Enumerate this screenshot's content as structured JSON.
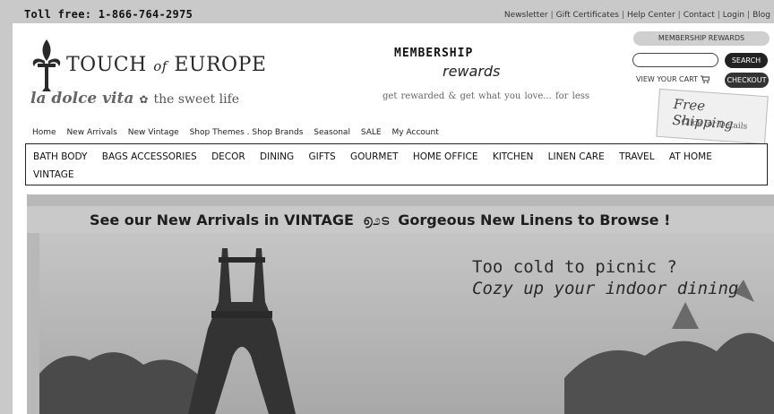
{
  "topbar": {
    "toll_free": "Toll free: 1-866-764-2975",
    "links": [
      "Newsletter",
      "Gift Certificates",
      "Help Center",
      "Contact",
      "Login",
      "Blog"
    ]
  },
  "logo": {
    "brand_left": "TOUCH",
    "brand_of": "of",
    "brand_right": "EUROPE",
    "tagline_script": "la dolce vita",
    "tagline_sep": "✿",
    "tagline_text": "the sweet life"
  },
  "membership": {
    "title": "MEMBERSHIP",
    "rewards": "rewards",
    "subtitle": "get rewarded  &  get what you love...  for less"
  },
  "utility": {
    "membership_rewards_label": "MEMBERSHIP REWARDS",
    "search_placeholder": "",
    "search_label": "SEARCH",
    "view_cart_label": "VIEW YOUR CART",
    "checkout_label": "CHECKOUT",
    "free_shipping_title": "Free Shipping",
    "free_shipping_sub": "Click for Details"
  },
  "main_nav": [
    "Home",
    "New Arrivals",
    "New Vintage",
    "Shop Themes . Shop Brands",
    "Seasonal",
    "SALE",
    "My Account"
  ],
  "categories_row1": [
    "BATH BODY",
    "BAGS ACCESSORIES",
    "DECOR",
    "DINING",
    "GIFTS",
    "GOURMET",
    "HOME OFFICE",
    "KITCHEN",
    "LINEN CARE",
    "TRAVEL",
    "AT HOME"
  ],
  "categories_row2": "VINTAGE",
  "hero": {
    "banner_left": "See our New Arrivals in VINTAGE",
    "banner_swirl": "൭೨ട",
    "banner_right": "Gorgeous New Linens to Browse !",
    "caption_line1": "Too cold to picnic ?",
    "caption_line2": "Cozy up your indoor dining"
  }
}
